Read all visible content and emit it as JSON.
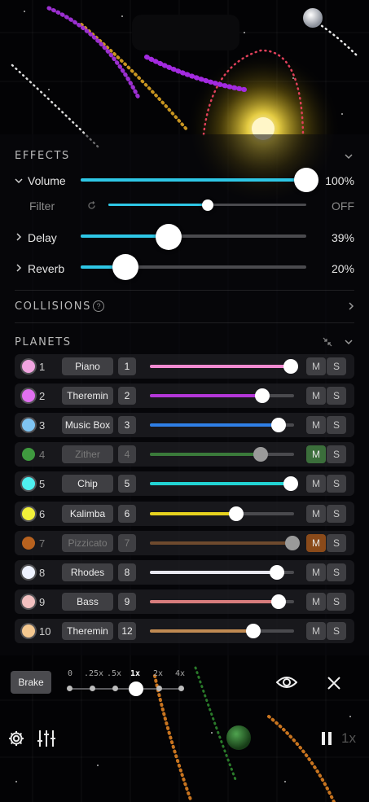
{
  "effects": {
    "title": "EFFECTS",
    "volume": {
      "label": "Volume",
      "value_text": "100%",
      "level": 1.0
    },
    "filter": {
      "label": "Filter",
      "value_text": "OFF",
      "level": 0.5
    },
    "delay": {
      "label": "Delay",
      "value_text": "39%",
      "level": 0.39
    },
    "reverb": {
      "label": "Reverb",
      "value_text": "20%",
      "level": 0.2
    }
  },
  "collisions": {
    "title": "COLLISIONS",
    "help": "?"
  },
  "planets": {
    "title": "PLANETS",
    "mute_label": "M",
    "solo_label": "S",
    "rows": [
      {
        "num": "1",
        "name": "Piano",
        "index": "1",
        "color": "#f08ad0",
        "dot": "#f0a4e0",
        "level": 0.98,
        "muted": false,
        "dim": false
      },
      {
        "num": "2",
        "name": "Theremin",
        "index": "2",
        "color": "#b437d8",
        "dot": "#e070f0",
        "level": 0.78,
        "muted": false,
        "dim": false
      },
      {
        "num": "3",
        "name": "Music Box",
        "index": "3",
        "color": "#2f7fe6",
        "dot": "#7fc4f2",
        "level": 0.89,
        "muted": false,
        "dim": false
      },
      {
        "num": "4",
        "name": "Zither",
        "index": "4",
        "color": "#3a7a3a",
        "dot": "#3f9a3f",
        "level": 0.77,
        "muted": true,
        "dim": true,
        "mute_color": "#3b6e3b"
      },
      {
        "num": "5",
        "name": "Chip",
        "index": "5",
        "color": "#22d3d3",
        "dot": "#4ff0f0",
        "level": 0.98,
        "muted": false,
        "dim": false
      },
      {
        "num": "6",
        "name": "Kalimba",
        "index": "6",
        "color": "#e6d21f",
        "dot": "#f2f03a",
        "level": 0.6,
        "muted": false,
        "dim": false
      },
      {
        "num": "7",
        "name": "Pizzicato",
        "index": "7",
        "color": "#6e4a2e",
        "dot": "#b8621f",
        "level": 0.99,
        "muted": true,
        "dim": true,
        "mute_color": "#8a4a1a"
      },
      {
        "num": "8",
        "name": "Rhodes",
        "index": "8",
        "color": "#e8e8f0",
        "dot": "#eef2ff",
        "level": 0.88,
        "muted": false,
        "dim": false
      },
      {
        "num": "9",
        "name": "Bass",
        "index": "9",
        "color": "#d87d7d",
        "dot": "#f2c0c0",
        "level": 0.89,
        "muted": false,
        "dim": false
      },
      {
        "num": "10",
        "name": "Theremin",
        "index": "12",
        "color": "#c08a52",
        "dot": "#f4c890",
        "level": 0.72,
        "muted": false,
        "dim": false
      }
    ]
  },
  "playback": {
    "brake_label": "Brake",
    "speeds": [
      "0",
      ".25x",
      ".5x",
      "1x",
      "2x",
      "4x"
    ],
    "selected_speed": "1x",
    "rate_indicator": "1x"
  },
  "colors": {
    "accent": "#2ec7e6",
    "sun": "#ffe34a"
  }
}
